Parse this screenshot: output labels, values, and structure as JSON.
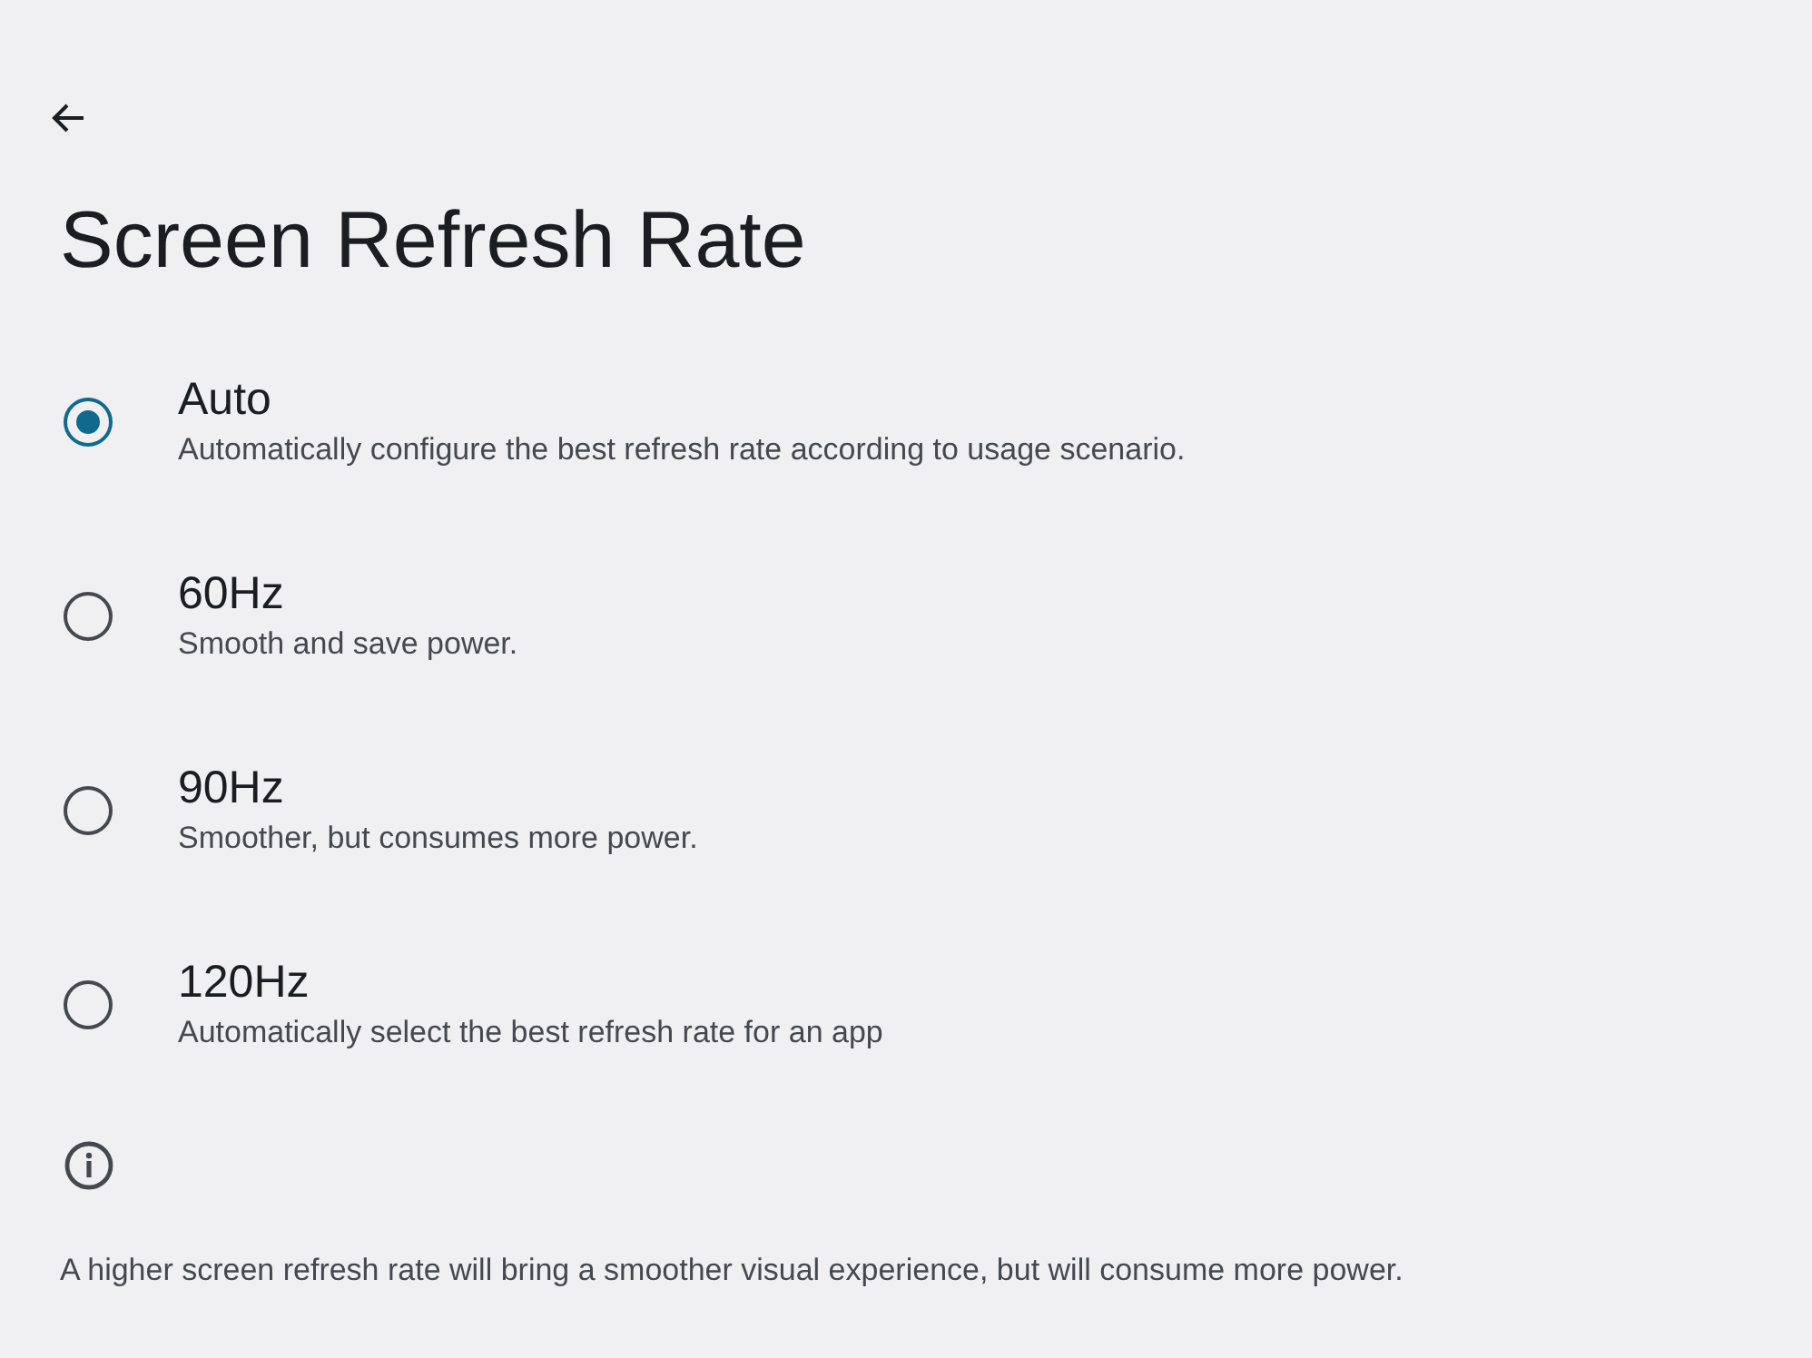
{
  "title": "Screen Refresh Rate",
  "options": [
    {
      "label": "Auto",
      "description": "Automatically configure the best refresh rate according to usage scenario.",
      "selected": true
    },
    {
      "label": "60Hz",
      "description": "Smooth and save power.",
      "selected": false
    },
    {
      "label": "90Hz",
      "description": "Smoother, but consumes more power.",
      "selected": false
    },
    {
      "label": "120Hz",
      "description": "Automatically select the best refresh rate for an app",
      "selected": false
    }
  ],
  "info_note": "A higher screen refresh rate will bring a smoother visual experience, but will consume more power."
}
